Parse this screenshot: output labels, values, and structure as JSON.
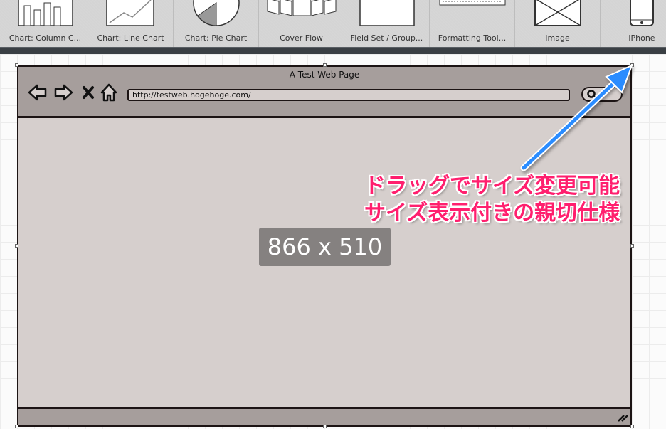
{
  "library": {
    "items": [
      {
        "label": "Chart: Column C..."
      },
      {
        "label": "Chart: Line Chart"
      },
      {
        "label": "Chart: Pie Chart"
      },
      {
        "label": "Cover Flow"
      },
      {
        "label": "Field Set / Group..."
      },
      {
        "label": "Formatting Tool..."
      },
      {
        "label": "Image"
      },
      {
        "label": "iPhone"
      }
    ]
  },
  "browser": {
    "title": "A Test Web Page",
    "url": "http://testweb.hogehoge.com/",
    "icons": [
      "back-arrow-icon",
      "forward-arrow-icon",
      "stop-x-icon",
      "home-icon",
      "search-icon",
      "resize-grip-icon"
    ]
  },
  "size_badge": "866 x 510",
  "annotation": {
    "line1": "ドラッグでサイズ変更可能",
    "line2": "サイズ表示付きの親切仕様",
    "color": "#ff1f6e",
    "arrow_color": "#2a8cff"
  }
}
